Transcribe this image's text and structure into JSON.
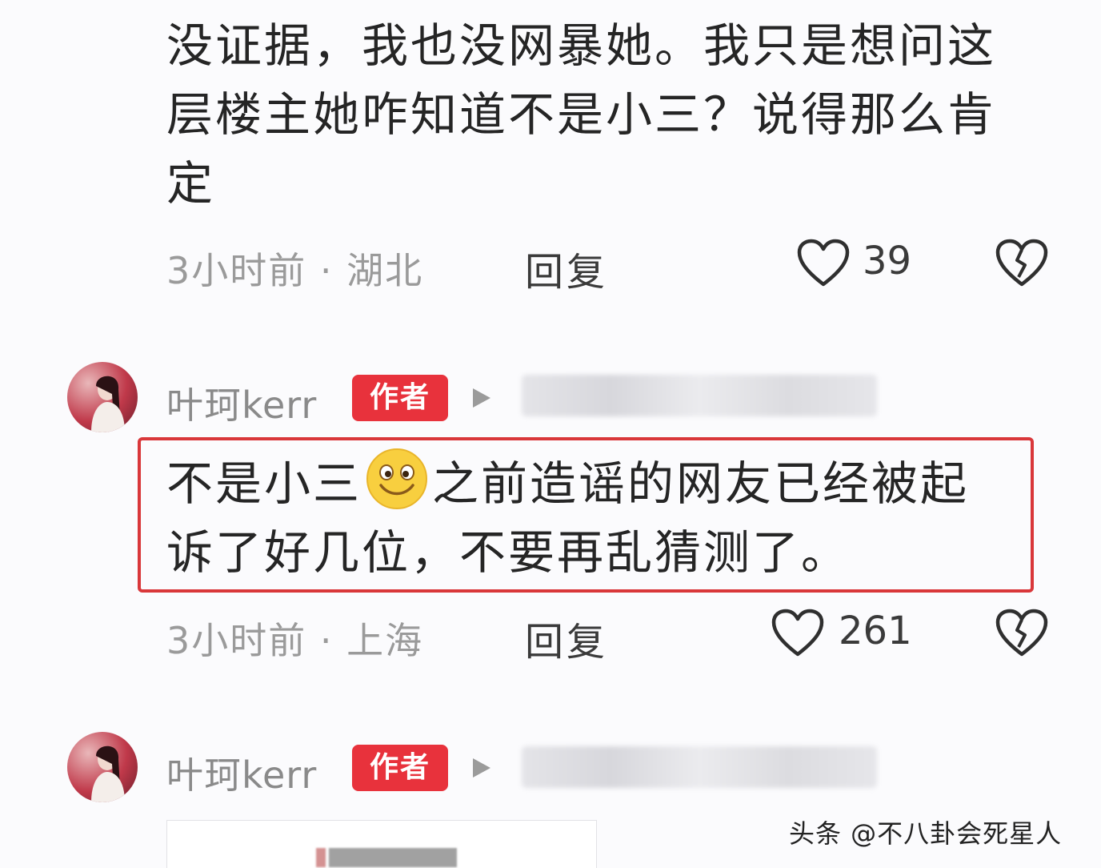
{
  "comment1": {
    "lines": [
      "没证据，我也没网暴她。我只是想问这",
      "层楼主她咋知道不是小三？说得那么肯",
      "定"
    ],
    "meta": "3小时前 · 湖北",
    "reply_label": "回复",
    "like_count": "39"
  },
  "comment2": {
    "username": "叶珂kerr",
    "badge": "作者",
    "line1_before_emoji": "不是小三",
    "line1_after_emoji": "之前造谣的网友已经被起",
    "line2": "诉了好几位，不要再乱猜测了。",
    "meta": "3小时前 · 上海",
    "reply_label": "回复",
    "like_count": "261"
  },
  "comment3": {
    "username": "叶珂kerr",
    "badge": "作者"
  },
  "watermark": "头条 @不八卦会死星人",
  "colors": {
    "badge": "#e8323c",
    "highlight_box": "#d9373a",
    "background": "#fbfbfd"
  },
  "icons": [
    "heart-icon",
    "broken-heart-icon",
    "play-triangle-icon",
    "smile-emoji-icon"
  ]
}
